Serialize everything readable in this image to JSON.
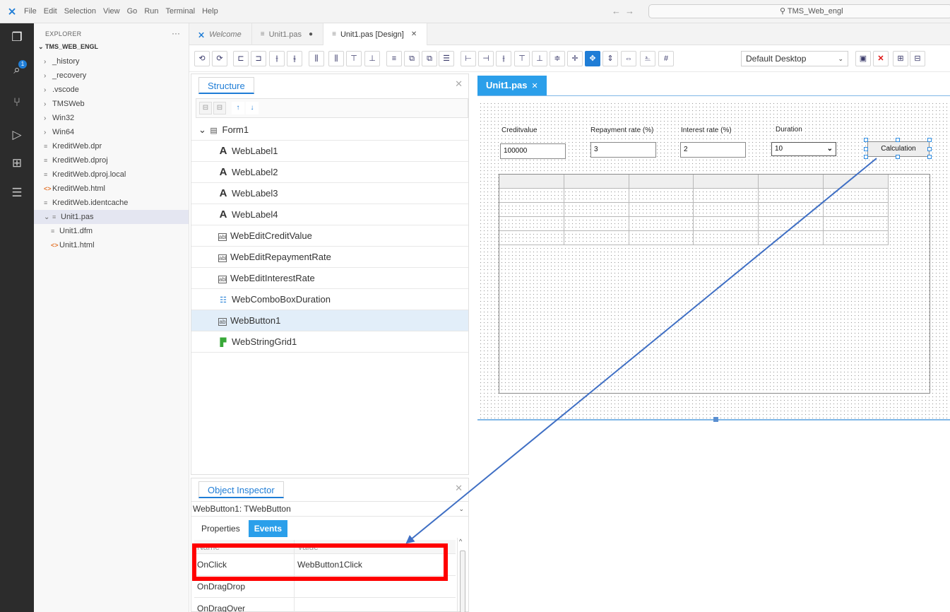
{
  "menu": [
    "File",
    "Edit",
    "Selection",
    "View",
    "Go",
    "Run",
    "Terminal",
    "Help"
  ],
  "search": {
    "text": "TMS_Web_engl"
  },
  "activity": {
    "badge": "1"
  },
  "explorer": {
    "header": "EXPLORER",
    "more": "···",
    "root": "TMS_WEB_ENGL",
    "items": [
      {
        "label": "_history",
        "type": "folder",
        "depth": 1,
        "expanded": false
      },
      {
        "label": "_recovery",
        "type": "folder",
        "depth": 1,
        "expanded": false
      },
      {
        "label": ".vscode",
        "type": "folder",
        "depth": 1,
        "expanded": false
      },
      {
        "label": "TMSWeb",
        "type": "folder",
        "depth": 1,
        "expanded": false
      },
      {
        "label": "Win32",
        "type": "folder",
        "depth": 1,
        "expanded": false
      },
      {
        "label": "Win64",
        "type": "folder",
        "depth": 1,
        "expanded": false
      },
      {
        "label": "KreditWeb.dpr",
        "type": "file",
        "depth": 1
      },
      {
        "label": "KreditWeb.dproj",
        "type": "file",
        "depth": 1
      },
      {
        "label": "KreditWeb.dproj.local",
        "type": "file",
        "depth": 1
      },
      {
        "label": "KreditWeb.html",
        "type": "html",
        "depth": 1
      },
      {
        "label": "KreditWeb.identcache",
        "type": "file",
        "depth": 1
      },
      {
        "label": "Unit1.pas",
        "type": "file",
        "depth": 1,
        "expanded": true,
        "selected": true
      },
      {
        "label": "Unit1.dfm",
        "type": "file",
        "depth": 2
      },
      {
        "label": "Unit1.html",
        "type": "html",
        "depth": 2
      }
    ]
  },
  "tabs": [
    {
      "label": "Welcome",
      "italic": true,
      "icon": "vscode-logo-icon",
      "extra": ""
    },
    {
      "label": "Unit1.pas",
      "italic": false,
      "icon": "file-lines-icon",
      "extra": "●"
    },
    {
      "label": "Unit1.pas [Design]",
      "italic": false,
      "icon": "file-lines-icon",
      "extra": "✕",
      "active": true
    }
  ],
  "toolbar": {
    "desktop_select": "Default Desktop"
  },
  "structure": {
    "title": "Structure",
    "close": "✕",
    "tools": [
      "⊟",
      "⊟",
      "↑",
      "↓"
    ],
    "root": "Form1",
    "nodes": [
      {
        "label": "WebLabel1",
        "kind": "label"
      },
      {
        "label": "WebLabel2",
        "kind": "label"
      },
      {
        "label": "WebLabel3",
        "kind": "label"
      },
      {
        "label": "WebLabel4",
        "kind": "label"
      },
      {
        "label": "WebEditCreditValue",
        "kind": "edit"
      },
      {
        "label": "WebEditRepaymentRate",
        "kind": "edit"
      },
      {
        "label": "WebEditInterestRate",
        "kind": "edit"
      },
      {
        "label": "WebComboBoxDuration",
        "kind": "combo"
      },
      {
        "label": "WebButton1",
        "kind": "button",
        "selected": true
      },
      {
        "label": "WebStringGrid1",
        "kind": "grid"
      }
    ]
  },
  "inspector": {
    "title": "Object Inspector",
    "close": "✕",
    "object": "WebButton1: TWebButton",
    "tabs": [
      "Properties",
      "Events"
    ],
    "active_tab": "Events",
    "col_name": "Name",
    "col_value": "Value",
    "rows": [
      {
        "name": "OnClick",
        "value": "WebButton1Click"
      },
      {
        "name": "OnDragDrop",
        "value": ""
      },
      {
        "name": "OnDragOver",
        "value": ""
      }
    ]
  },
  "designer": {
    "tab_label": "Unit1.pas",
    "tab_close": "✕",
    "labels": {
      "credit": "Creditvalue",
      "repayment": "Repayment rate (%)",
      "interest": "Interest rate (%)",
      "duration": "Duration"
    },
    "edits": {
      "credit": "100000",
      "repayment": "3",
      "interest": "2",
      "duration": "10"
    },
    "button": "Calculation",
    "grid": {
      "columns": 6,
      "rows": 5
    }
  },
  "colors": {
    "accent": "#1f7dd6",
    "highlight_box": "#ff0000",
    "arrow": "#3f6fc4",
    "activity_bar": "#2c2c2c"
  }
}
